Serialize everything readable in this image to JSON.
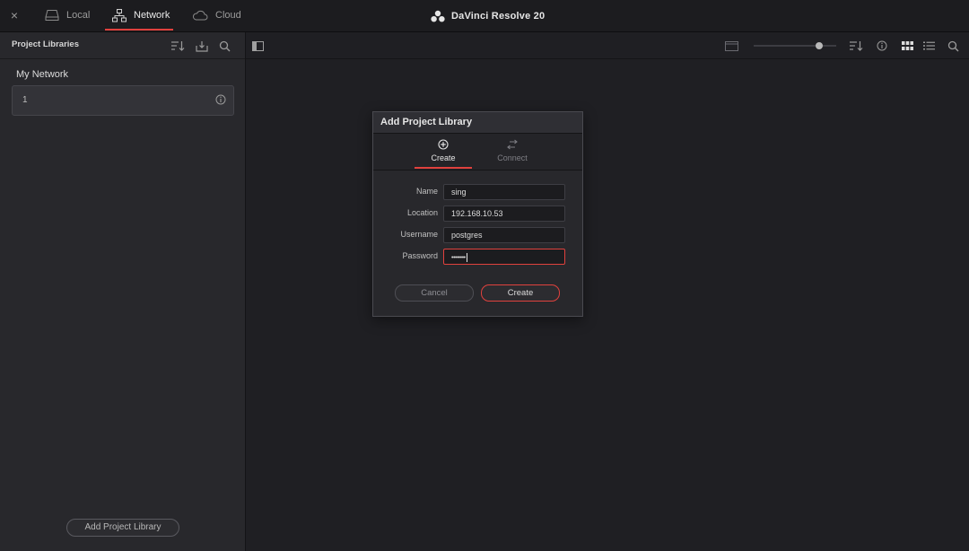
{
  "window": {
    "close_glyph": "×",
    "title": "DaVinci Resolve 20"
  },
  "tabs": [
    {
      "label": "Local",
      "icon": "drive-icon",
      "active": false
    },
    {
      "label": "Network",
      "icon": "network-icon",
      "active": true
    },
    {
      "label": "Cloud",
      "icon": "cloud-icon",
      "active": false
    }
  ],
  "sidebar": {
    "title": "Project Libraries",
    "section": "My Network",
    "libraries": [
      {
        "name": "1"
      }
    ],
    "add_button": "Add Project Library"
  },
  "dialog": {
    "title": "Add Project Library",
    "tabs": [
      {
        "label": "Create",
        "icon": "plus-circle-icon",
        "active": true
      },
      {
        "label": "Connect",
        "icon": "connect-arrows-icon",
        "active": false
      }
    ],
    "fields": {
      "name": {
        "label": "Name",
        "value": "sing"
      },
      "location": {
        "label": "Location",
        "value": "192.168.10.53"
      },
      "username": {
        "label": "Username",
        "value": "postgres"
      },
      "password": {
        "label": "Password",
        "value": "••••••••"
      }
    },
    "cancel_label": "Cancel",
    "create_label": "Create"
  },
  "colors": {
    "accent": "#e0413d",
    "background": "#1f1f23",
    "sidebar": "#28282c"
  }
}
